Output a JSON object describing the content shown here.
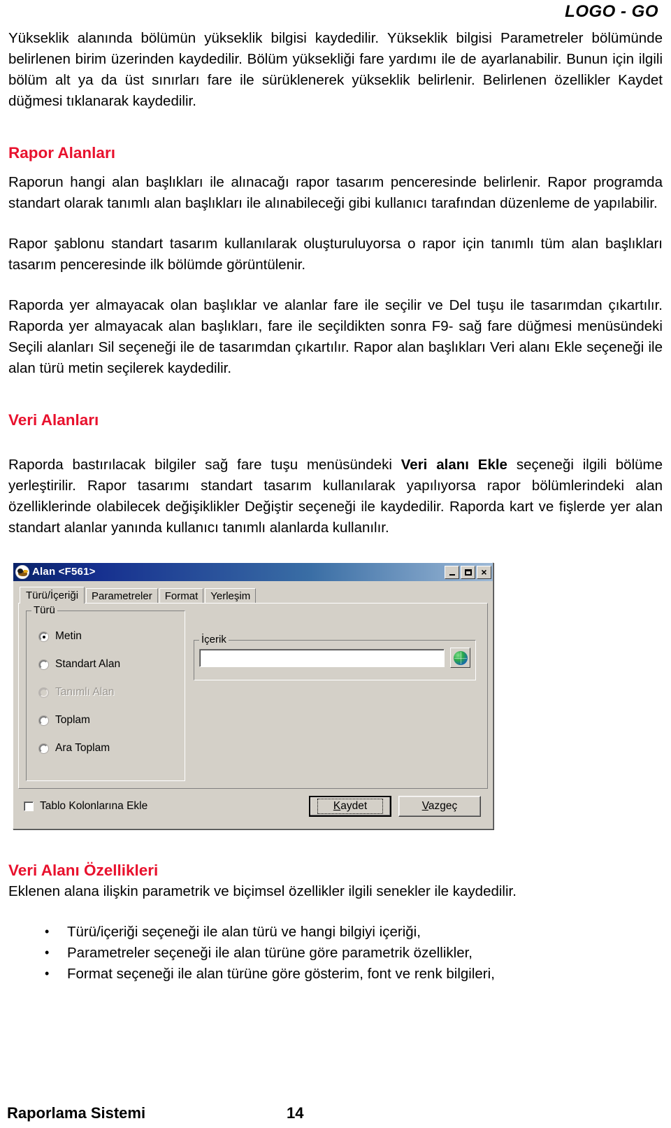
{
  "header": {
    "logo": "LOGO - GO"
  },
  "body": {
    "intro_paragraph": "Yükseklik alanında bölümün yükseklik bilgisi kaydedilir. Yükseklik bilgisi Parametreler bölümünde belirlenen birim üzerinden kaydedilir. Bölüm yüksekliği fare yardımı ile de ayarlanabilir. Bunun için ilgili bölüm alt ya da üst sınırları fare ile sürüklenerek yükseklik belirlenir. Belirlenen özellikler Kaydet düğmesi tıklanarak kaydedilir.",
    "section1_heading": "Rapor Alanları",
    "section1_p1": "Raporun hangi alan başlıkları ile alınacağı rapor tasarım penceresinde belirlenir. Rapor programda standart olarak tanımlı alan başlıkları ile alınabileceği gibi kullanıcı tarafından düzenleme de yapılabilir.",
    "section1_p2": "Rapor şablonu standart tasarım kullanılarak oluşturuluyorsa o rapor için tanımlı tüm alan başlıkları tasarım penceresinde ilk bölümde görüntülenir.",
    "section1_p3": "Raporda yer almayacak olan başlıklar ve alanlar fare ile seçilir ve Del tuşu ile tasarımdan çıkartılır. Raporda yer almayacak alan başlıkları, fare ile seçildikten sonra F9- sağ fare düğmesi menüsündeki Seçili alanları Sil seçeneği ile de tasarımdan çıkartılır. Rapor alan başlıkları Veri alanı Ekle seçeneği ile alan türü metin seçilerek kaydedilir.",
    "section2_heading": "Veri Alanları",
    "section2_p1_part1": "Raporda bastırılacak bilgiler sağ fare tuşu menüsündeki ",
    "section2_p1_bold": "Veri alanı Ekle",
    "section2_p1_part2": " seçeneği ilgili bölüme yerleştirilir. Rapor tasarımı standart tasarım kullanılarak yapılıyorsa rapor bölümlerindeki alan özelliklerinde olabilecek değişiklikler Değiştir seçeneği ile kaydedilir. Raporda kart ve fişlerde yer alan standart alanlar yanında kullanıcı tanımlı alanlarda kullanılır.",
    "section3_heading": "Veri Alanı Özellikleri",
    "section3_p1": "Eklenen alana ilişkin parametrik ve biçimsel özellikler ilgili senekler ile kaydedilir.",
    "bullets": [
      "Türü/içeriği seçeneği ile alan türü ve hangi bilgiyi içeriği,",
      "Parametreler seçeneği ile alan türüne göre parametrik özellikler,",
      "Format seçeneği ile alan türüne göre gösterim, font ve renk bilgileri,"
    ]
  },
  "dialog": {
    "title": "Alan <F561>",
    "titlebar_buttons": {
      "minimize": "minimize-icon",
      "maximize": "maximize-icon",
      "close": "×"
    },
    "tabs": [
      {
        "label": "Türü/İçeriği",
        "active": true
      },
      {
        "label": "Parametreler",
        "active": false
      },
      {
        "label": "Format",
        "active": false
      },
      {
        "label": "Yerleşim",
        "active": false
      }
    ],
    "turu_group": {
      "title": "Türü",
      "options": [
        {
          "label": "Metin",
          "checked": true,
          "disabled": false
        },
        {
          "label": "Standart Alan",
          "checked": false,
          "disabled": false
        },
        {
          "label": "Tanımlı Alan",
          "checked": false,
          "disabled": true
        },
        {
          "label": "Toplam",
          "checked": false,
          "disabled": false
        },
        {
          "label": "Ara Toplam",
          "checked": false,
          "disabled": false
        }
      ]
    },
    "icerik_group": {
      "title": "İçerik",
      "input_value": "",
      "input_placeholder": "",
      "browse_icon": "globe-icon"
    },
    "checkbox": {
      "label": "Tablo Kolonlarına Ekle",
      "checked": false
    },
    "buttons": {
      "save_accel": "K",
      "save_rest": "aydet",
      "cancel_accel": "V",
      "cancel_rest": "azgeç"
    }
  },
  "footer": {
    "title": "Raporlama Sistemi",
    "page": "14"
  },
  "colors": {
    "heading_red": "#e8112d",
    "dialog_face": "#d4d0c8",
    "titlebar_dark": "#0a246a",
    "titlebar_light": "#9db9d6"
  }
}
